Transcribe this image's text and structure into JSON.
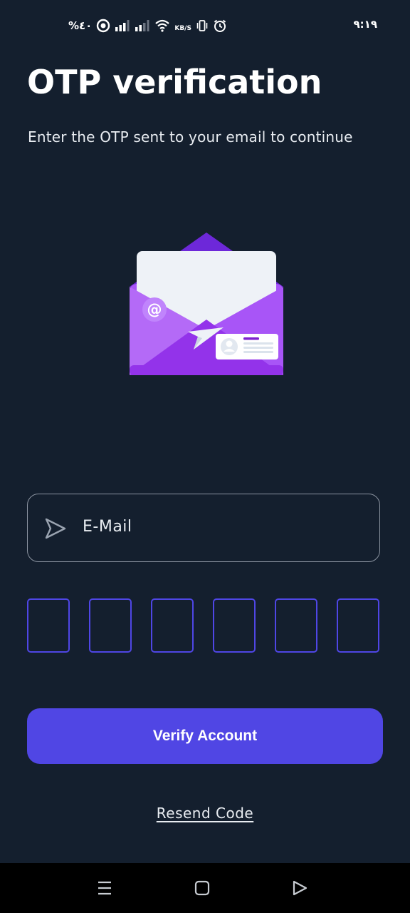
{
  "status_bar": {
    "battery": "%٤٠",
    "speed_unit": "KB/S",
    "time": "٩:١٩",
    "icons": [
      "battery-saver-icon",
      "signal-icon",
      "signal-icon",
      "wifi-icon",
      "vibrate-icon",
      "alarm-icon"
    ]
  },
  "header": {
    "title": "OTP verification",
    "subtitle": "Enter the OTP sent to your email to continue"
  },
  "illustration": {
    "icon": "envelope-illustration-icon",
    "colors": {
      "envelope": "#a855f7",
      "envelope_dark": "#7e22ce",
      "letter": "#eef2f7"
    }
  },
  "form": {
    "email_placeholder": "E-Mail",
    "email_icon": "send-arrow-icon",
    "otp_digits": [
      "",
      "",
      "",
      "",
      "",
      ""
    ],
    "verify_label": "Verify Account",
    "resend_label": "Resend Code"
  },
  "colors": {
    "background": "#141f2e",
    "accent": "#5046e4",
    "otp_border": "#4f46e5",
    "field_border": "#8b93a0"
  },
  "nav_bar": {
    "items": [
      "menu-icon",
      "home-icon",
      "back-icon"
    ]
  }
}
